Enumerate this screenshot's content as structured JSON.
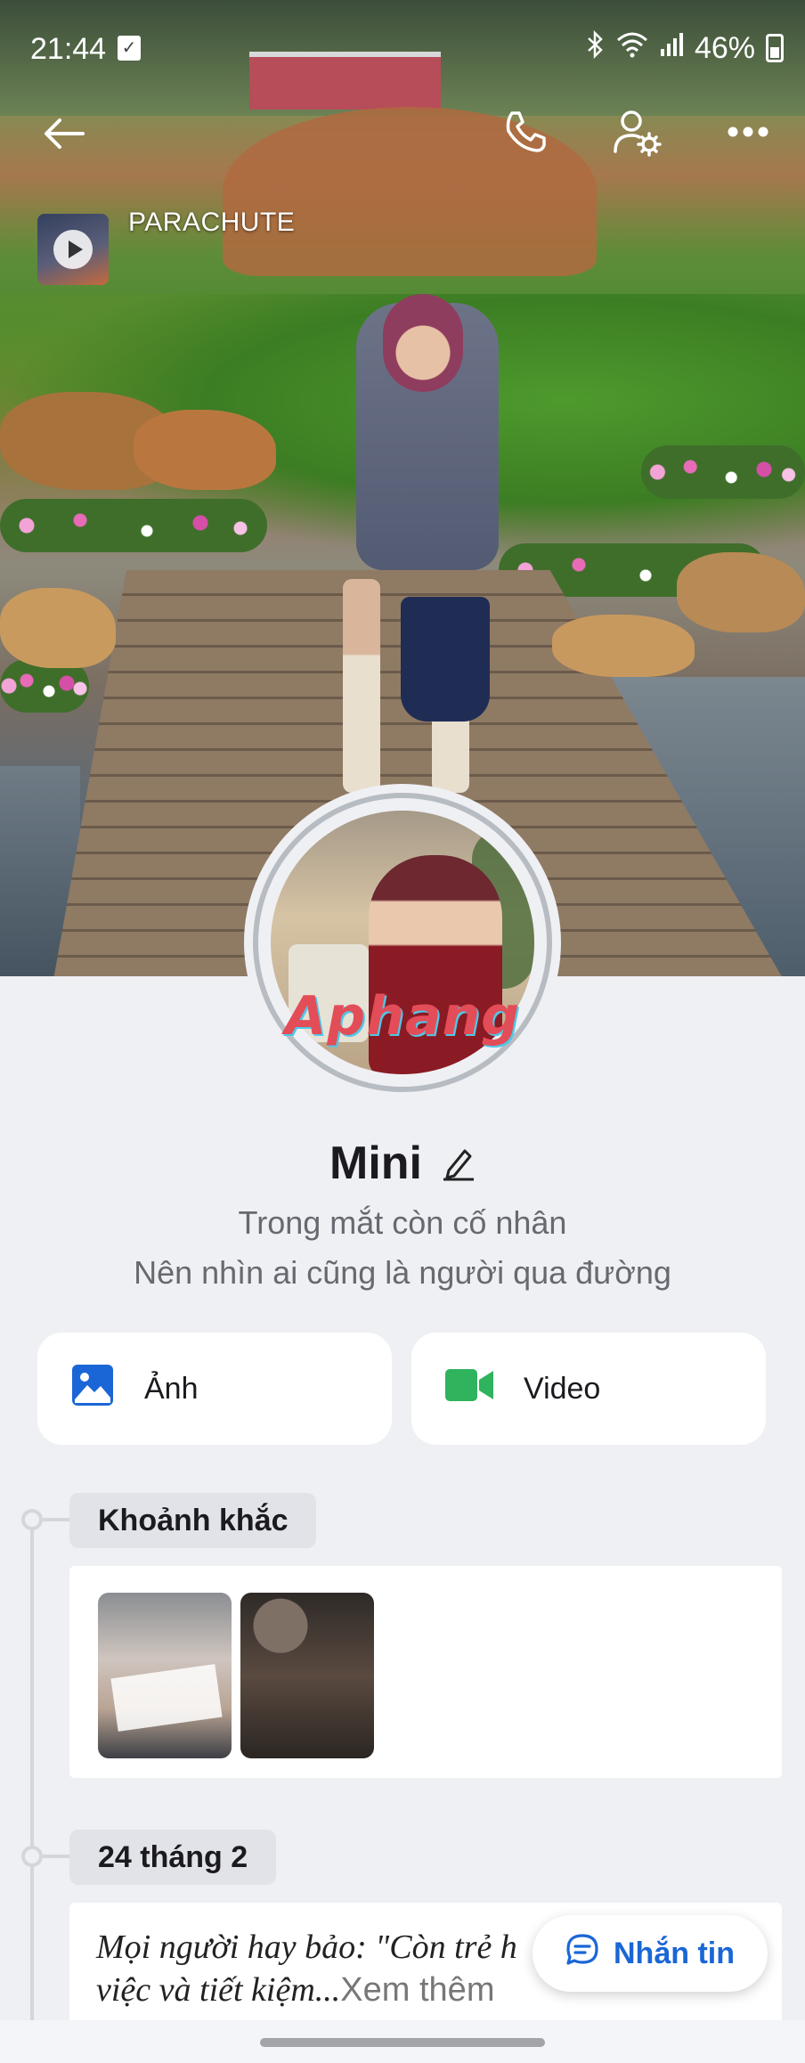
{
  "status_bar": {
    "time": "21:44",
    "battery": "46%"
  },
  "music": {
    "title": "PARACHUTE"
  },
  "avatar": {
    "watermark": "Aphang"
  },
  "profile": {
    "name": "Mini",
    "bio_line1": "Trong mắt còn cố nhân",
    "bio_line2": "Nên nhìn ai cũng là người qua đường"
  },
  "actions": {
    "photo_label": "Ảnh",
    "video_label": "Video"
  },
  "timeline": {
    "moments_label": "Khoảnh khắc",
    "post_date": "24 tháng 2",
    "post_text": "Mọi người hay bảo: \"Còn trẻ h",
    "post_text_line2": "việc và tiết kiệm...",
    "see_more": "Xem thêm"
  },
  "message_button": {
    "label": "Nhắn tin"
  },
  "colors": {
    "accent": "#1a66d6",
    "background": "#eff0f4",
    "photo_icon": "#1a66d6",
    "video_icon": "#2fb35d"
  },
  "icons": [
    "back-icon",
    "phone-icon",
    "user-settings-icon",
    "more-icon",
    "edit-icon",
    "image-icon",
    "video-icon",
    "chat-icon"
  ]
}
